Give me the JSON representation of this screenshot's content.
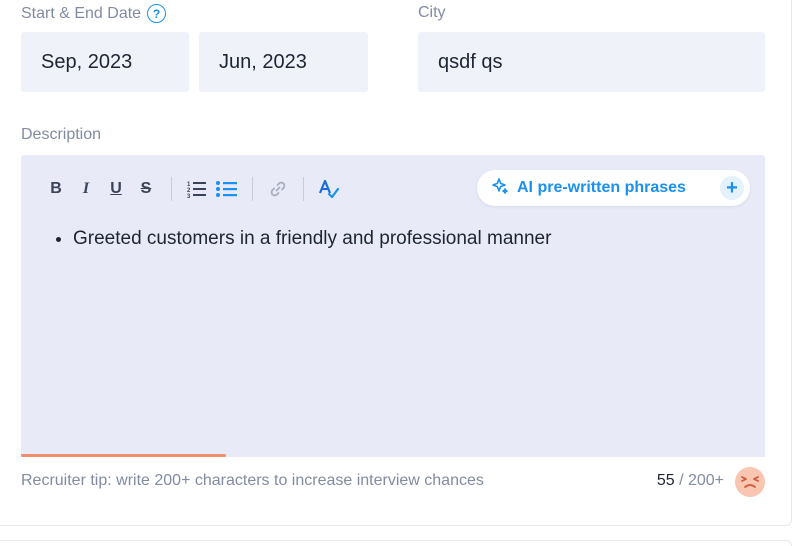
{
  "dates": {
    "label": "Start & End Date",
    "help_icon": "?",
    "start_value": "Sep, 2023",
    "end_value": "Jun, 2023"
  },
  "city": {
    "label": "City",
    "value": "qsdf qs"
  },
  "description": {
    "label": "Description",
    "toolbar": {
      "bold": "B",
      "italic": "I",
      "underline": "U",
      "strike": "S",
      "icons": [
        "ordered-list-icon",
        "bullet-list-icon",
        "link-icon",
        "spellcheck-icon"
      ]
    },
    "ai_button": {
      "label": "AI pre-written phrases",
      "icon": "sparkle-icon",
      "plus": "+"
    },
    "bullets": [
      "Greeted customers in a friendly and professional manner"
    ],
    "progress": 0.275
  },
  "footer": {
    "tip": "Recruiter tip: write 200+ characters to increase interview chances",
    "count_current": "55",
    "count_target": " / 200+",
    "emoji": "frowning-face-icon"
  },
  "colors": {
    "accent": "#1a91f0",
    "field_bg": "#eff2f9",
    "editor_bg": "#e8eaf8",
    "progress": "#ee8e6c",
    "muted_text": "#828ba2"
  }
}
